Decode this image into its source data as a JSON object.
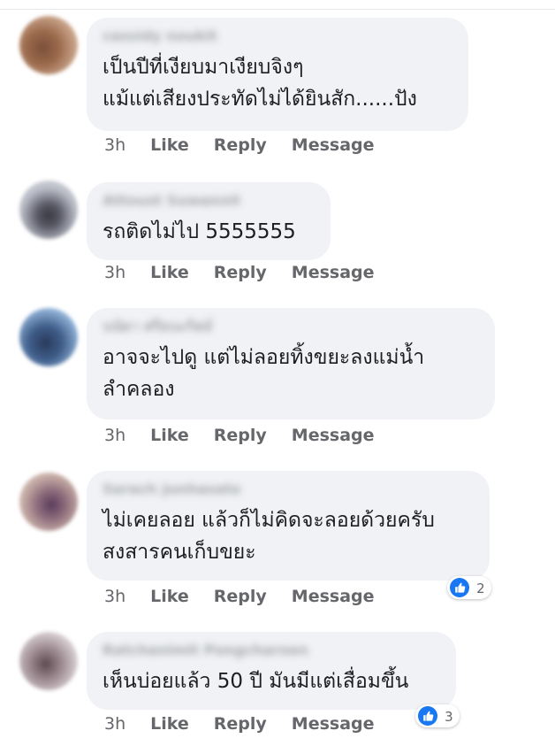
{
  "colors": {
    "bubble": "#f0f2f5",
    "meta_text": "#65676b",
    "body_text": "#1c1e21",
    "like_blue": "#1877f2"
  },
  "comments": [
    {
      "author": "cassidy noukit",
      "text_lines": [
        "เป็นปีที่เงียบมาเงียบจิงๆ",
        "แม้แต่เสียงประทัดไม่ได้ยินสัก......ปัง"
      ],
      "time": "3h",
      "like_label": "Like",
      "reply_label": "Reply",
      "message_label": "Message"
    },
    {
      "author": "Attoust Suwannit",
      "text_lines": [
        "รถติดไม่ไป 5555555"
      ],
      "time": "3h",
      "like_label": "Like",
      "reply_label": "Reply",
      "message_label": "Message"
    },
    {
      "author": "นนัดา ศรีธนะกิตย์",
      "text_lines": [
        "อาจจะไปดู แต่ไม่ลอยทิ้งขยะลงแม่น้ำ",
        "ลำคลอง"
      ],
      "time": "3h",
      "like_label": "Like",
      "reply_label": "Reply",
      "message_label": "Message"
    },
    {
      "author": "Sarach Junhasatan",
      "text_lines": [
        "ไม่เคยลอย แล้วก็ไม่คิดจะลอยด้วยครับ",
        "สงสารคนเก็บขยะ"
      ],
      "time": "3h",
      "like_label": "Like",
      "reply_label": "Reply",
      "message_label": "Message",
      "reaction_icon": "thumbs-up-icon",
      "reaction_count": "2"
    },
    {
      "author": "Ratchanimit Pongcharoen",
      "text_lines": [
        "เห็นบ่อยแล้ว 50 ปี มันมีแต่เสื่อมขึ้น"
      ],
      "time": "3h",
      "like_label": "Like",
      "reply_label": "Reply",
      "message_label": "Message",
      "reaction_icon": "thumbs-up-icon",
      "reaction_count": "3"
    }
  ]
}
